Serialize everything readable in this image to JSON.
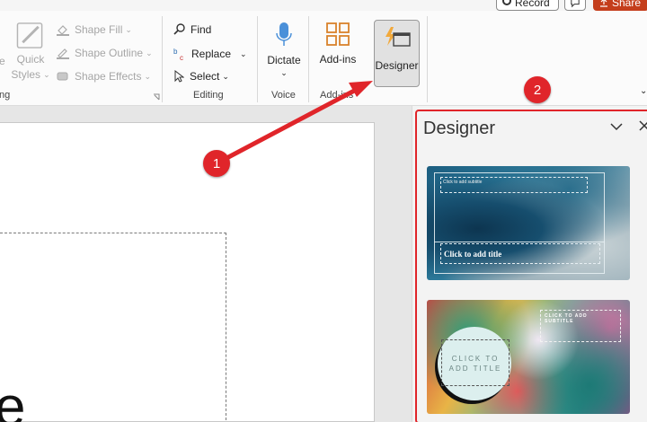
{
  "topbar": {
    "record_label": "Record",
    "share_label": "Share"
  },
  "ribbon": {
    "drawing_group_label": "ng",
    "quick_styles_label_1": "Quick",
    "quick_styles_label_2": "Styles",
    "left_cut_label": "e",
    "shape_fill": "Shape Fill",
    "shape_outline": "Shape Outline",
    "shape_effects": "Shape Effects",
    "find": "Find",
    "replace": "Replace",
    "select": "Select",
    "editing_label": "Editing",
    "dictate": "Dictate",
    "voice_label": "Voice",
    "addins": "Add-ins",
    "addins_group_label": "Add-ins",
    "designer": "Designer"
  },
  "designer_pane": {
    "title": "Designer",
    "thumb1": {
      "subtitle": "Click to add subtitle",
      "title": "Click to add title"
    },
    "thumb2": {
      "title": "CLICK TO ADD TITLE",
      "subtitle": "CLICK TO ADD SUBTITLE"
    }
  },
  "slide": {
    "partial_text": "e"
  },
  "annotations": {
    "badge1": "1",
    "badge2": "2",
    "color": "#e0252a"
  },
  "icons": [
    "record-icon",
    "comment-icon",
    "share-icon",
    "quick-styles-icon",
    "shape-fill-icon",
    "shape-outline-icon",
    "shape-effects-icon",
    "find-icon",
    "replace-icon",
    "select-icon",
    "microphone-icon",
    "addins-icon",
    "designer-icon",
    "chevron-down-icon",
    "close-icon"
  ]
}
